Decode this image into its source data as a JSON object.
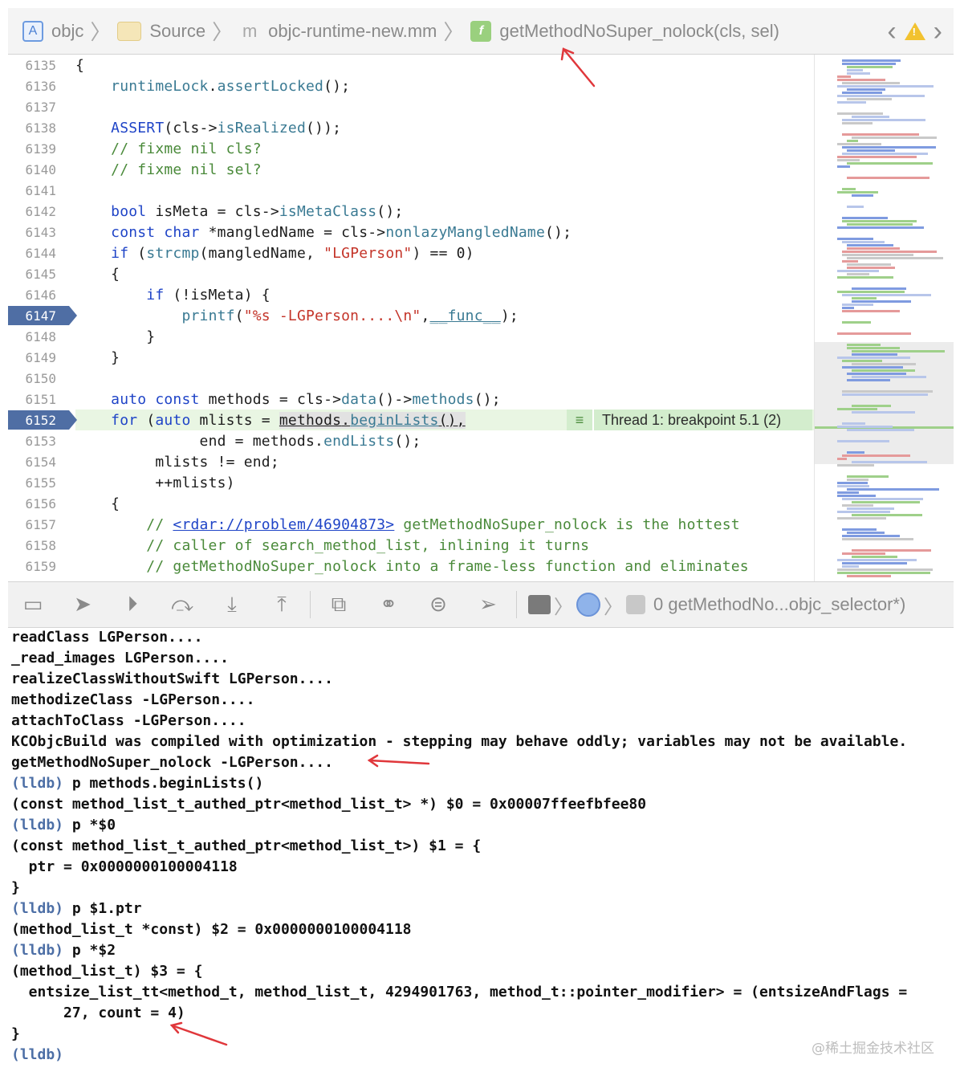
{
  "jumpbar": {
    "crumbs": [
      {
        "label": "objc",
        "icon": "project-icon"
      },
      {
        "label": "Source",
        "icon": "folder-icon"
      },
      {
        "label": "objc-runtime-new.mm",
        "icon": "objc-file-icon"
      },
      {
        "label": "getMethodNoSuper_nolock(cls, sel)",
        "icon": "function-icon"
      }
    ],
    "project_badge": "A",
    "file_badge": "m",
    "function_badge": "f",
    "back_glyph": "‹",
    "warn_glyph": "!",
    "forward_glyph": "›"
  },
  "editor": {
    "lines": [
      {
        "num": "6135"
      },
      {
        "num": "6136"
      },
      {
        "num": "6137"
      },
      {
        "num": "6138"
      },
      {
        "num": "6139"
      },
      {
        "num": "6140"
      },
      {
        "num": "6141"
      },
      {
        "num": "6142"
      },
      {
        "num": "6143"
      },
      {
        "num": "6144"
      },
      {
        "num": "6145"
      },
      {
        "num": "6146"
      },
      {
        "num": "6147"
      },
      {
        "num": "6148"
      },
      {
        "num": "6149"
      },
      {
        "num": "6150"
      },
      {
        "num": "6151"
      },
      {
        "num": "6152"
      },
      {
        "num": "6153"
      },
      {
        "num": "6154"
      },
      {
        "num": "6155"
      },
      {
        "num": "6156"
      },
      {
        "num": "6157"
      },
      {
        "num": "6158"
      },
      {
        "num": "6159"
      }
    ],
    "code": {
      "l6135": "{",
      "l6136_a": "runtimeLock",
      "l6136_b": ".",
      "l6136_c": "assertLocked",
      "l6136_d": "();",
      "l6138_a": "ASSERT",
      "l6138_b": "(cls->",
      "l6138_c": "isRealized",
      "l6138_d": "());",
      "l6139": "// fixme nil cls?",
      "l6140": "// fixme nil sel?",
      "l6142_a": "bool",
      "l6142_b": " isMeta = cls->",
      "l6142_c": "isMetaClass",
      "l6142_d": "();",
      "l6143_a": "const",
      "l6143_b": "char",
      "l6143_c": " *mangledName = cls->",
      "l6143_d": "nonlazyMangledName",
      "l6143_e": "();",
      "l6144_a": "if",
      "l6144_b": " (",
      "l6144_c": "strcmp",
      "l6144_d": "(mangledName, ",
      "l6144_e": "\"LGPerson\"",
      "l6144_f": ") == 0)",
      "l6145": "{",
      "l6146_a": "if",
      "l6146_b": " (!isMeta) {",
      "l6147_a": "printf",
      "l6147_b": "(",
      "l6147_c": "\"%s -LGPerson....\\n\"",
      "l6147_d": ",",
      "l6147_e": "__func__",
      "l6147_f": ");",
      "l6148": "}",
      "l6149": "}",
      "l6151_a": "auto",
      "l6151_b": "const",
      "l6151_c": " methods = cls->",
      "l6151_d": "data",
      "l6151_e": "()->",
      "l6151_f": "methods",
      "l6151_g": "();",
      "l6152_a": "for",
      "l6152_b": " (",
      "l6152_c": "auto",
      "l6152_d": " mlists = ",
      "l6152_e": "methods",
      "l6152_f": ".",
      "l6152_g": "beginLists",
      "l6152_h": "(),",
      "l6153_a": "end = methods.",
      "l6153_b": "endLists",
      "l6153_c": "();",
      "l6154": "mlists != end;",
      "l6155": "++mlists)",
      "l6156": "{",
      "l6157_a": "// ",
      "l6157_b": "<rdar://problem/46904873>",
      "l6157_c": " getMethodNoSuper_nolock is the hottest",
      "l6158": "// caller of search_method_list, inlining it turns",
      "l6159": "// getMethodNoSuper_nolock into a frame-less function and eliminates"
    },
    "breakpoint_lines": [
      "6147",
      "6152"
    ],
    "thread_badge": "Thread 1: breakpoint 5.1 (2)",
    "thread_badge_glyph": "≡"
  },
  "debugbar": {
    "buttons": [
      {
        "name": "hide-debug-area-button",
        "glyph": "▭"
      },
      {
        "name": "breakpoints-toggle-button",
        "glyph": "➤"
      },
      {
        "name": "continue-button",
        "glyph": "⏵"
      },
      {
        "name": "step-over-button",
        "glyph": "⤼"
      },
      {
        "name": "step-into-button",
        "glyph": "⤓"
      },
      {
        "name": "step-out-button",
        "glyph": "⤒"
      },
      {
        "name": "view-hierarchy-button",
        "glyph": "⧉"
      },
      {
        "name": "memory-graph-button",
        "glyph": "⚭"
      },
      {
        "name": "environment-overrides-button",
        "glyph": "⊜"
      },
      {
        "name": "simulate-location-button",
        "glyph": "➢"
      }
    ],
    "frame_path": "0 getMethodNo...objc_selector*)"
  },
  "console": {
    "lines": [
      {
        "prompt": "",
        "text": "readClass LGPerson...."
      },
      {
        "prompt": "",
        "text": "_read_images LGPerson...."
      },
      {
        "prompt": "",
        "text": "realizeClassWithoutSwift LGPerson...."
      },
      {
        "prompt": "",
        "text": "methodizeClass -LGPerson...."
      },
      {
        "prompt": "",
        "text": "attachToClass -LGPerson...."
      },
      {
        "prompt": "",
        "text": "KCObjcBuild was compiled with optimization - stepping may behave oddly; variables may not be available."
      },
      {
        "prompt": "",
        "text": "getMethodNoSuper_nolock -LGPerson...."
      },
      {
        "prompt": "(lldb)",
        "text": " p methods.beginLists()"
      },
      {
        "prompt": "",
        "text": "(const method_list_t_authed_ptr<method_list_t> *) $0 = 0x00007ffeefbfee80"
      },
      {
        "prompt": "(lldb)",
        "text": " p *$0"
      },
      {
        "prompt": "",
        "text": "(const method_list_t_authed_ptr<method_list_t>) $1 = {"
      },
      {
        "prompt": "",
        "text": "  ptr = 0x0000000100004118"
      },
      {
        "prompt": "",
        "text": "}"
      },
      {
        "prompt": "(lldb)",
        "text": " p $1.ptr"
      },
      {
        "prompt": "",
        "text": "(method_list_t *const) $2 = 0x0000000100004118"
      },
      {
        "prompt": "(lldb)",
        "text": " p *$2"
      },
      {
        "prompt": "",
        "text": "(method_list_t) $3 = {"
      },
      {
        "prompt": "",
        "text": "  entsize_list_tt<method_t, method_list_t, 4294901763, method_t::pointer_modifier> = (entsizeAndFlags ="
      },
      {
        "prompt": "",
        "text": "      27, count = 4)"
      },
      {
        "prompt": "",
        "text": "}"
      },
      {
        "prompt": "(lldb)",
        "text": ""
      }
    ],
    "watermark": "@稀土掘金技术社区"
  },
  "colors": {
    "keyword": "#1f44c7",
    "function": "#3a7a93",
    "string": "#c4352a",
    "comment": "#4a8a3a",
    "breakpoint": "#4f6ea4",
    "current_line": "#e9f6e3",
    "lldb_prompt": "#4d6fa6",
    "annotation_arrow": "#e0373b"
  }
}
